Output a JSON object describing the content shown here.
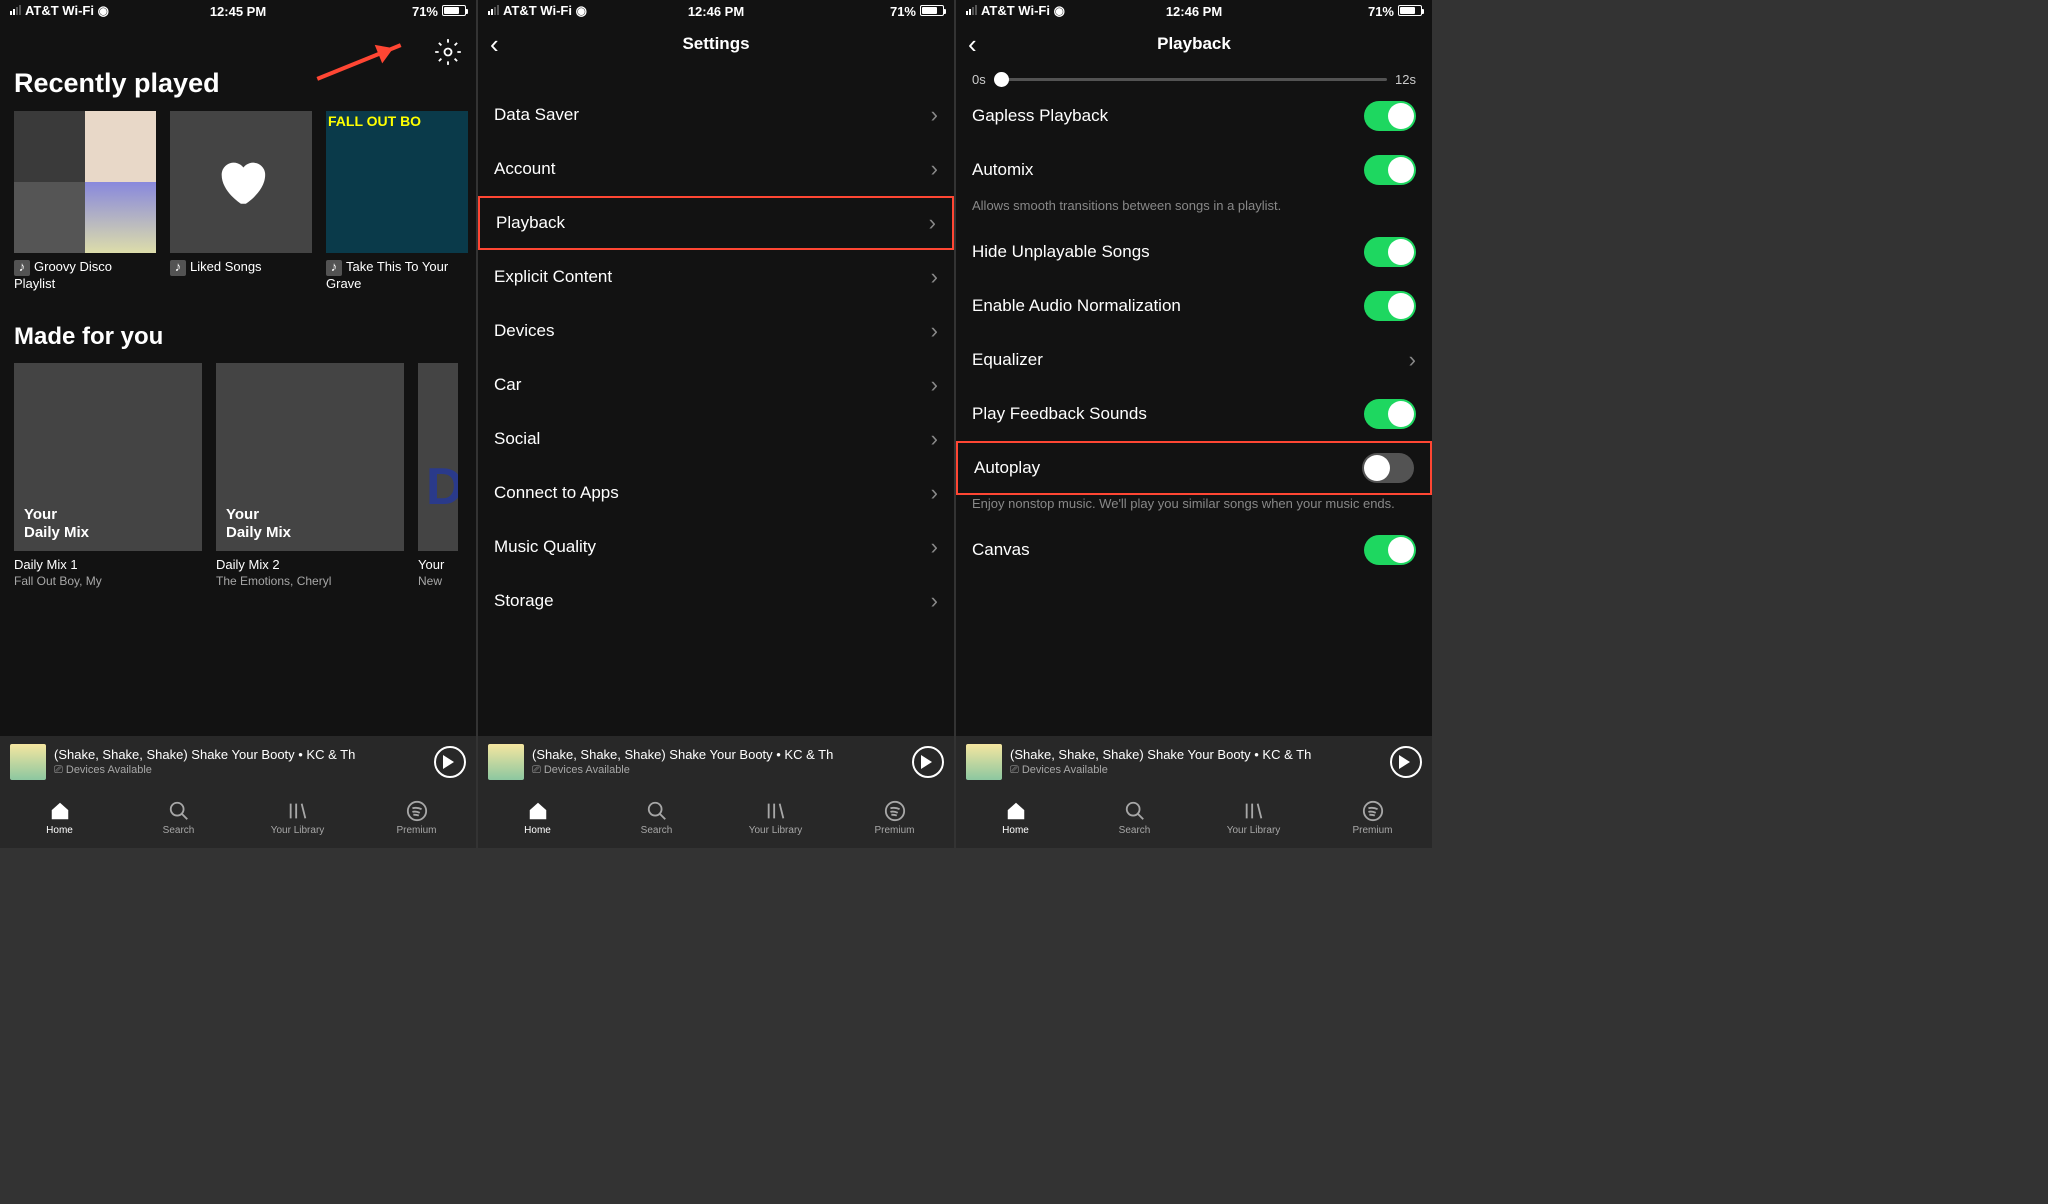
{
  "statusbar": {
    "carrier": "AT&T Wi-Fi",
    "battery": "71%",
    "battery_pct": 71
  },
  "screen1": {
    "time": "12:45 PM",
    "h1": "Recently played",
    "recent": [
      {
        "label": "Groovy Disco Playlist"
      },
      {
        "label": "Liked Songs"
      },
      {
        "label": "Take This To Your Grave"
      }
    ],
    "h2": "Made for you",
    "mixes": [
      {
        "title": "Daily Mix 1",
        "sub": "Fall Out Boy, My",
        "overlay": "Your\nDaily Mix"
      },
      {
        "title": "Daily Mix 2",
        "sub": "The Emotions, Cheryl",
        "overlay": "Your\nDaily Mix"
      },
      {
        "title": "Your",
        "sub": "New",
        "overlay": "D"
      }
    ]
  },
  "screen2": {
    "time": "12:46 PM",
    "title": "Settings",
    "items": [
      "Data Saver",
      "Account",
      "Playback",
      "Explicit Content",
      "Devices",
      "Car",
      "Social",
      "Connect to Apps",
      "Music Quality",
      "Storage"
    ],
    "highlight_index": 2
  },
  "screen3": {
    "time": "12:46 PM",
    "title": "Playback",
    "slider": {
      "min": "0s",
      "max": "12s"
    },
    "rows": [
      {
        "label": "Gapless Playback",
        "type": "toggle",
        "on": true
      },
      {
        "label": "Automix",
        "type": "toggle",
        "on": true,
        "desc": "Allows smooth transitions between songs in a playlist."
      },
      {
        "label": "Hide Unplayable Songs",
        "type": "toggle",
        "on": true
      },
      {
        "label": "Enable Audio Normalization",
        "type": "toggle",
        "on": true
      },
      {
        "label": "Equalizer",
        "type": "chev"
      },
      {
        "label": "Play Feedback Sounds",
        "type": "toggle",
        "on": true
      },
      {
        "label": "Autoplay",
        "type": "toggle",
        "on": false,
        "hl": true,
        "desc": "Enjoy nonstop music. We'll play you similar songs when your music ends."
      },
      {
        "label": "Canvas",
        "type": "toggle",
        "on": true
      }
    ]
  },
  "nowplaying": {
    "song": "(Shake, Shake, Shake) Shake Your Booty • KC & Th",
    "devices": "Devices Available"
  },
  "tabs": [
    "Home",
    "Search",
    "Your Library",
    "Premium"
  ]
}
